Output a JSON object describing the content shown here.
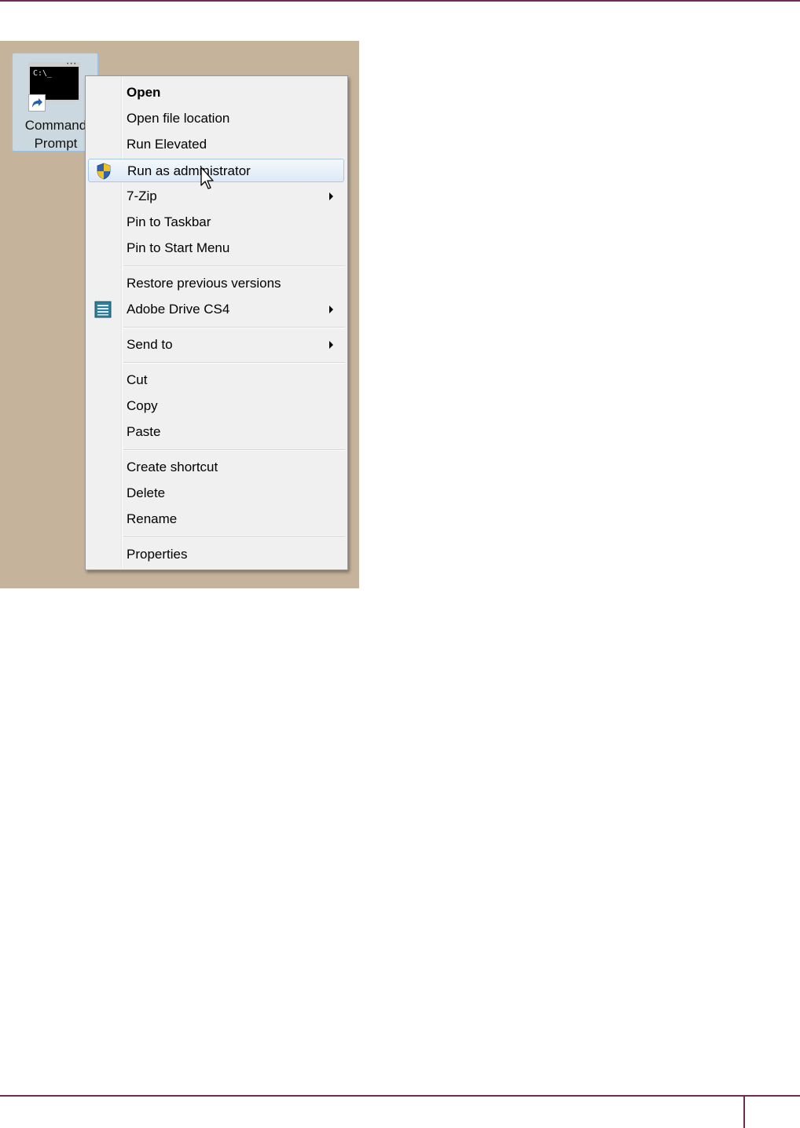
{
  "desktop": {
    "icon_label": "Command\nPrompt",
    "console_text": "C:\\_"
  },
  "menu": {
    "items": [
      {
        "label": "Open",
        "bold": true
      },
      {
        "label": "Open file location"
      },
      {
        "label": "Run Elevated"
      },
      {
        "label": "Run as administrator",
        "icon": "uac-shield-icon",
        "highlighted": true
      },
      {
        "label": "7-Zip",
        "submenu": true
      },
      {
        "label": "Pin to Taskbar"
      },
      {
        "label": "Pin to Start Menu"
      },
      {
        "label": "Restore previous versions"
      },
      {
        "label": "Adobe Drive CS4",
        "icon": "adobe-drive-icon",
        "submenu": true
      },
      {
        "label": "Send to",
        "submenu": true
      },
      {
        "label": "Cut"
      },
      {
        "label": "Copy"
      },
      {
        "label": "Paste"
      },
      {
        "label": "Create shortcut"
      },
      {
        "label": "Delete"
      },
      {
        "label": "Rename"
      },
      {
        "label": "Properties"
      }
    ]
  },
  "colors": {
    "desktop_bg": "#c6b39b",
    "page_rule": "#6b2d5c",
    "menu_bg": "#f0f0f0",
    "highlight_border": "#a9c9ec"
  }
}
